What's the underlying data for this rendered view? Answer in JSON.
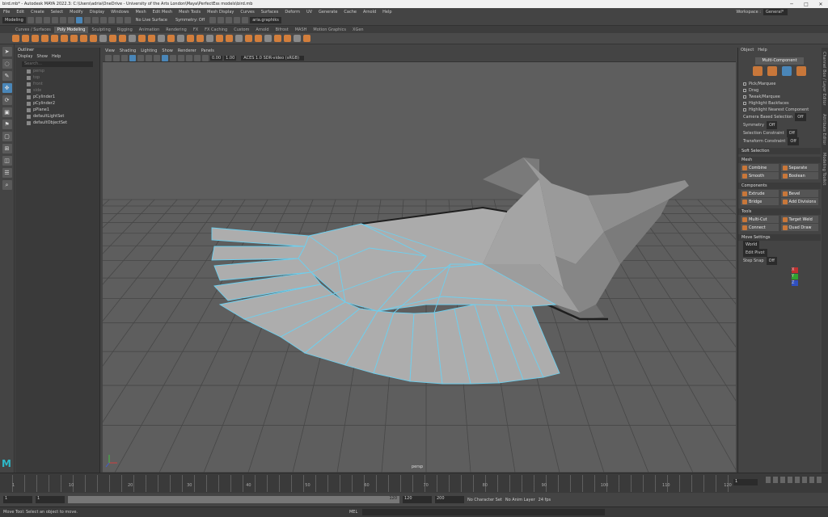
{
  "title": "bird.mb* - Autodesk MAYA 2022.3: C:\\Users\\adria\\OneDrive - University of the Arts London\\Maya\\PerfectEss models\\bird.mb",
  "window_controls": [
    "─",
    "□",
    "✕"
  ],
  "menus": [
    "File",
    "Edit",
    "Create",
    "Select",
    "Modify",
    "Display",
    "Windows",
    "Mesh",
    "Edit Mesh",
    "Mesh Tools",
    "Mesh Display",
    "Curves",
    "Surfaces",
    "Deform",
    "UV",
    "Generate",
    "Cache",
    "Arnold",
    "Help"
  ],
  "workspace": {
    "label": "Workspace :",
    "value": "General*"
  },
  "status": {
    "mode": "Modeling",
    "live_surface": "No Live Surface",
    "symmetry": "Symmetry: Off",
    "user": "aria.graphiks"
  },
  "shelf_tabs": [
    "Curves / Surfaces",
    "Poly Modeling",
    "Sculpting",
    "Rigging",
    "Animation",
    "Rendering",
    "FX",
    "FX Caching",
    "Custom",
    "Arnold",
    "Bifrost",
    "MASH",
    "Motion Graphics",
    "XGen"
  ],
  "active_shelf": "Poly Modeling",
  "outliner": {
    "title": "Outliner",
    "menu": [
      "Display",
      "Show",
      "Help"
    ],
    "search": "Search...",
    "items": [
      {
        "label": "persp",
        "dim": true
      },
      {
        "label": "top",
        "dim": true
      },
      {
        "label": "front",
        "dim": true
      },
      {
        "label": "side",
        "dim": true
      },
      {
        "label": "pCylinder1",
        "dim": false
      },
      {
        "label": "pCylinder2",
        "dim": false
      },
      {
        "label": "pPlane1",
        "dim": false
      },
      {
        "label": "defaultLightSet",
        "dim": false
      },
      {
        "label": "defaultObjectSet",
        "dim": false
      }
    ]
  },
  "viewport": {
    "menu": [
      "View",
      "Shading",
      "Lighting",
      "Show",
      "Renderer",
      "Panels"
    ],
    "val1": "0.00",
    "val2": "1.00",
    "colorspace": "ACES 1.0 SDR-video (sRGB)",
    "camera": "persp"
  },
  "modeling_toolkit": {
    "menu": [
      "Object",
      "Help"
    ],
    "multi_component": "Multi-Component",
    "select_options": [
      "Pick/Marquee",
      "Drag",
      "Tweak/Marquee",
      "Highlight Backfaces",
      "Highlight Nearest Component"
    ],
    "camera_based": "Camera Based Selection",
    "camera_based_val": "Off",
    "symmetry": "Symmetry",
    "symmetry_val": "Off",
    "selection_constraint": "Selection Constraint",
    "selection_constraint_val": "Off",
    "transform_constraint": "Transform Constraint",
    "transform_constraint_val": "Off",
    "soft_selection": "Soft Selection",
    "mesh_header": "Mesh",
    "mesh": [
      "Combine",
      "Separate",
      "Smooth",
      "Boolean"
    ],
    "components_header": "Components",
    "components": [
      "Extrude",
      "Bevel",
      "Bridge",
      "Add Divisions"
    ],
    "tools_header": "Tools",
    "tools": [
      "Multi-Cut",
      "Target Weld",
      "Connect",
      "Quad Draw"
    ],
    "move_header": "Move Settings",
    "move_space": "World",
    "edit_pivot": "Edit Pivot",
    "step_snap": "Step Snap",
    "step_snap_val": "Off",
    "axis": [
      "X",
      "Y",
      "Z"
    ]
  },
  "right_tabs": [
    "Channel Box / Layer Editor",
    "Attribute Editor",
    "Modeling Toolkit"
  ],
  "timeline": {
    "labels": [
      "1",
      "10",
      "20",
      "30",
      "40",
      "50",
      "60",
      "70",
      "80",
      "90",
      "100",
      "110",
      "120"
    ],
    "current": "1"
  },
  "range": {
    "start": "1",
    "start2": "1",
    "end": "120",
    "end2": "120",
    "end3": "200",
    "character": "No Character Set",
    "anim_layer": "No Anim Layer",
    "fps": "24 fps"
  },
  "help_line": "Move Tool: Select an object to move.",
  "mel": "MEL"
}
